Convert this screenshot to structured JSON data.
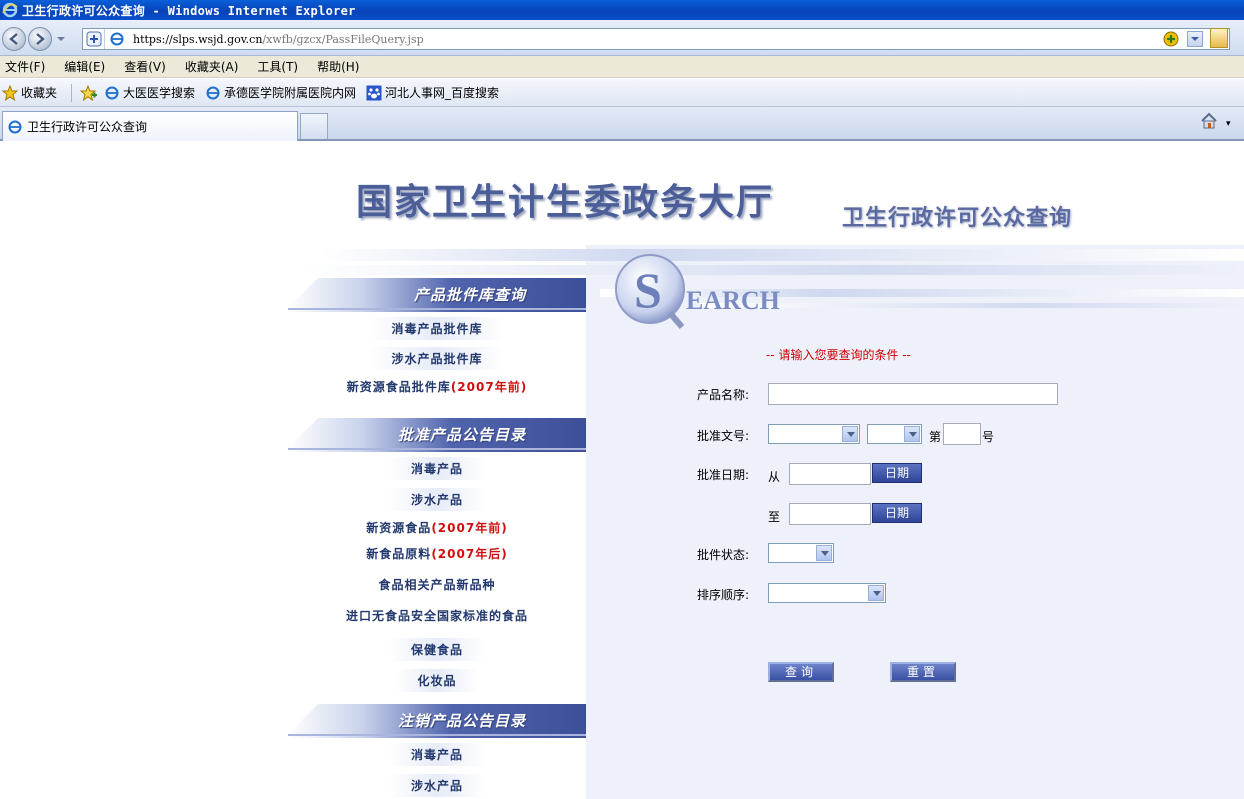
{
  "window": {
    "title": "卫生行政许可公众查询 - Windows Internet Explorer"
  },
  "address": {
    "host": "https://slps.wsjd.gov.cn",
    "path": "/xwfb/gzcx/PassFileQuery.jsp"
  },
  "menu": [
    "文件(F)",
    "编辑(E)",
    "查看(V)",
    "收藏夹(A)",
    "工具(T)",
    "帮助(H)"
  ],
  "favorites": {
    "label": "收藏夹",
    "items": [
      "大医医学搜索",
      "承德医学院附属医院内网",
      "河北人事网_百度搜索"
    ]
  },
  "tabs": [
    {
      "label": "卫生行政许可公众查询"
    }
  ],
  "page": {
    "banner_title": "国家卫生计生委政务大厅",
    "banner_subtitle": "卫生行政许可公众查询",
    "search_logo_s": "S",
    "search_logo_rest": "EARCH",
    "sections": [
      {
        "heading": "产品批件库查询",
        "links": [
          {
            "text": "消毒产品批件库",
            "red": ""
          },
          {
            "text": "涉水产品批件库",
            "red": ""
          },
          {
            "text": "新资源食品批件库",
            "red": "(2007年前)"
          }
        ]
      },
      {
        "heading": "批准产品公告目录",
        "links": [
          {
            "text": "消毒产品",
            "red": ""
          },
          {
            "text": "涉水产品",
            "red": ""
          },
          {
            "text": "新资源食品",
            "red": "(2007年前)"
          },
          {
            "text": "新食品原料",
            "red": "(2007年后)"
          },
          {
            "text": "食品相关产品新品种",
            "red": ""
          },
          {
            "text": "进口无食品安全国家标准的食品",
            "red": ""
          },
          {
            "text": "保健食品",
            "red": ""
          },
          {
            "text": "化妆品",
            "red": ""
          }
        ]
      },
      {
        "heading": "注销产品公告目录",
        "links": [
          {
            "text": "消毒产品",
            "red": ""
          },
          {
            "text": "涉水产品",
            "red": ""
          }
        ]
      }
    ],
    "form": {
      "hint": "-- 请输入您要查询的条件 --",
      "product_name_label": "产品名称:",
      "approval_no_label": "批准文号:",
      "approval_no_di": "第",
      "approval_no_hao": "号",
      "approval_date_label": "批准日期:",
      "from_label": "从",
      "to_label": "至",
      "date_button": "日期",
      "status_label": "批件状态:",
      "order_label": "排序顺序:",
      "query_button": "查询",
      "reset_button": "重置"
    }
  }
}
